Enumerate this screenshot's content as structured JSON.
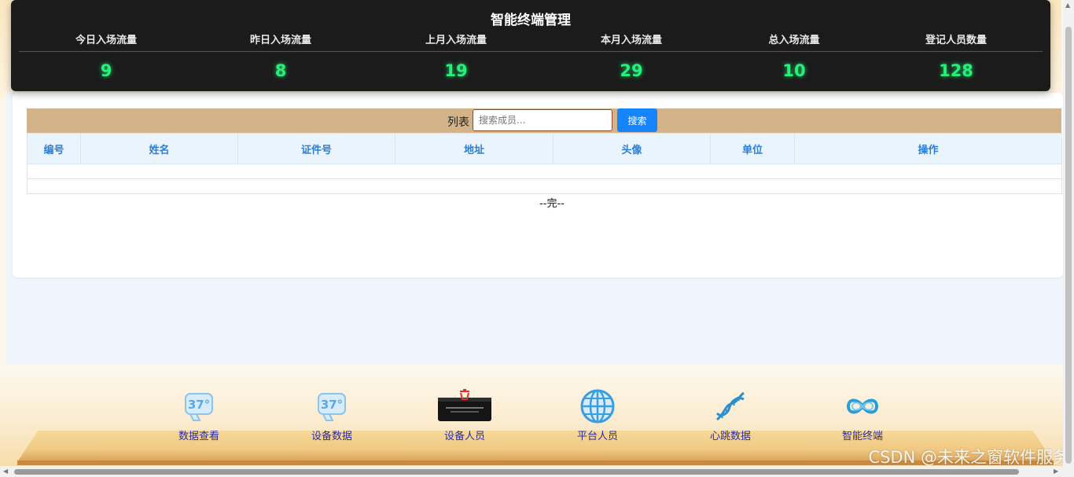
{
  "header": {
    "title": "智能终端管理",
    "stats": [
      {
        "label": "今日入场流量",
        "value": "9"
      },
      {
        "label": "昨日入场流量",
        "value": "8"
      },
      {
        "label": "上月入场流量",
        "value": "19"
      },
      {
        "label": "本月入场流量",
        "value": "29"
      },
      {
        "label": "总入场流量",
        "value": "10"
      },
      {
        "label": "登记人员数量",
        "value": "128"
      }
    ]
  },
  "toolbar": {
    "label": "列表",
    "search_placeholder": "搜索成员...",
    "search_button": "搜索"
  },
  "table": {
    "columns": [
      "编号",
      "姓名",
      "证件号",
      "地址",
      "头像",
      "单位",
      "操作"
    ],
    "end_text": "--完--"
  },
  "bottom_nav": [
    {
      "label": "数据查看",
      "icon": "thermometer-37-icon"
    },
    {
      "label": "设备数据",
      "icon": "thermometer-37-icon"
    },
    {
      "label": "设备人员",
      "icon": "device-box-icon"
    },
    {
      "label": "平台人员",
      "icon": "globe-icon"
    },
    {
      "label": "心跳数据",
      "icon": "dna-icon"
    },
    {
      "label": "智能终端",
      "icon": "infinity-icon"
    }
  ],
  "watermark": "CSDN @未来之窗软件服务",
  "colors": {
    "stat_value": "#27f07a",
    "header_bg": "#1b1b1b",
    "toolbar_bg": "#d3b48a",
    "search_button": "#1684fc",
    "table_header_text": "#2a7fd6",
    "nav_label": "#2a2aa8"
  }
}
